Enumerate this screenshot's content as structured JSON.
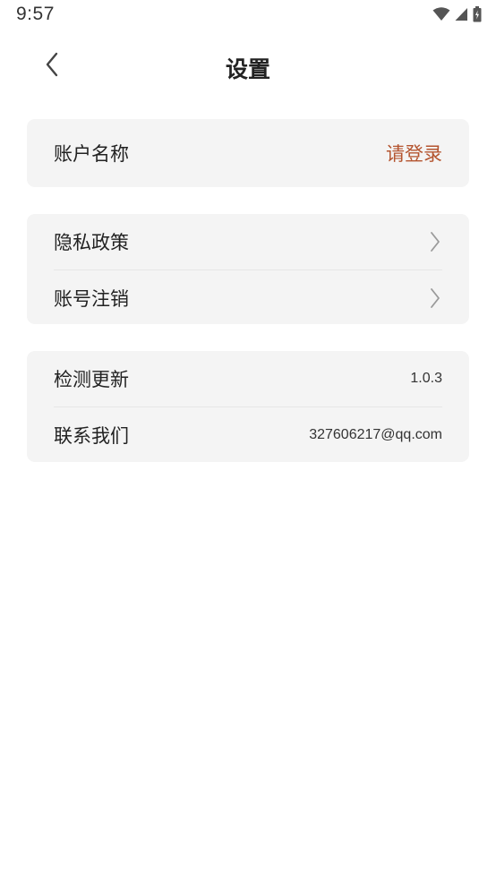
{
  "status_bar": {
    "time": "9:57",
    "icons": [
      "wifi-icon",
      "signal-icon",
      "battery-icon"
    ]
  },
  "header": {
    "title": "设置",
    "back_icon": "chevron-left-icon"
  },
  "account": {
    "label": "账户名称",
    "value": "请登录",
    "value_color": "#b4542f"
  },
  "policy": {
    "items": [
      {
        "label": "隐私政策",
        "icon": "chevron-right-icon"
      },
      {
        "label": "账号注销",
        "icon": "chevron-right-icon"
      }
    ]
  },
  "about": {
    "items": [
      {
        "label": "检测更新",
        "value": "1.0.3"
      },
      {
        "label": "联系我们",
        "value": "327606217@qq.com"
      }
    ]
  },
  "colors": {
    "card_background": "#f4f4f4",
    "accent": "#b4542f",
    "text": "#222222"
  }
}
